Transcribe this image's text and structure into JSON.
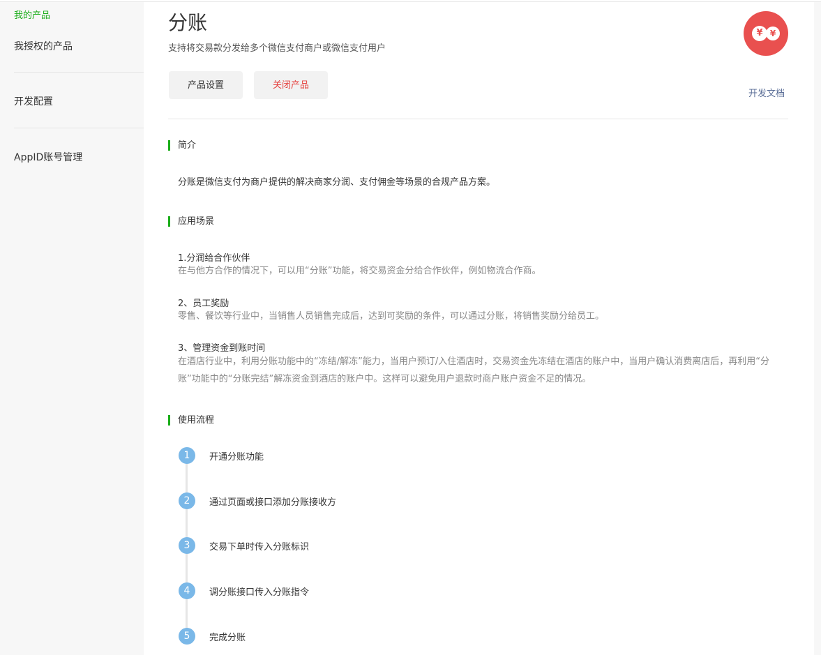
{
  "sidebar": {
    "items": [
      {
        "label": "我的产品",
        "active": true
      },
      {
        "label": "我授权的产品",
        "active": false
      },
      {
        "label": "开发配置",
        "active": false
      },
      {
        "label": "AppID账号管理",
        "active": false
      }
    ]
  },
  "header": {
    "title": "分账",
    "subtitle": "支持将交易款分发给多个微信支付商户或微信支付用户",
    "logo_icon": "yen-transfer-icon",
    "logo_color": "#e9504f",
    "logo_coin_left": "¥",
    "logo_coin_right": "¥",
    "settings_button": "产品设置",
    "close_button": "关闭产品",
    "doc_link": "开发文档"
  },
  "intro": {
    "title": "简介",
    "text": "分账是微信支付为商户提供的解决商家分润、支付佣金等场景的合规产品方案。"
  },
  "scenes": {
    "title": "应用场景",
    "items": [
      {
        "heading": "1.分润给合作伙伴",
        "desc": "在与他方合作的情况下，可以用“分账”功能，将交易资金分给合作伙伴，例如物流合作商。"
      },
      {
        "heading": "2、员工奖励",
        "desc": "零售、餐饮等行业中，当销售人员销售完成后，达到可奖励的条件，可以通过分账，将销售奖励分给员工。"
      },
      {
        "heading": "3、管理资金到账时间",
        "desc": "在酒店行业中，利用分账功能中的“冻结/解冻”能力，当用户预订/入住酒店时，交易资金先冻结在酒店的账户中，当用户确认消费离店后，再利用“分账”功能中的“分账完结”解冻资金到酒店的账户中。这样可以避免用户退款时商户账户资金不足的情况。"
      }
    ]
  },
  "flow": {
    "title": "使用流程",
    "steps": [
      {
        "num": "1",
        "label": "开通分账功能"
      },
      {
        "num": "2",
        "label": "通过页面或接口添加分账接收方"
      },
      {
        "num": "3",
        "label": "交易下单时传入分账标识"
      },
      {
        "num": "4",
        "label": "调分账接口传入分账指令"
      },
      {
        "num": "5",
        "label": "完成分账"
      }
    ]
  },
  "colors": {
    "accent": "#1aad19",
    "danger": "#e64340",
    "link": "#576b95",
    "step": "#7ab8e8"
  }
}
